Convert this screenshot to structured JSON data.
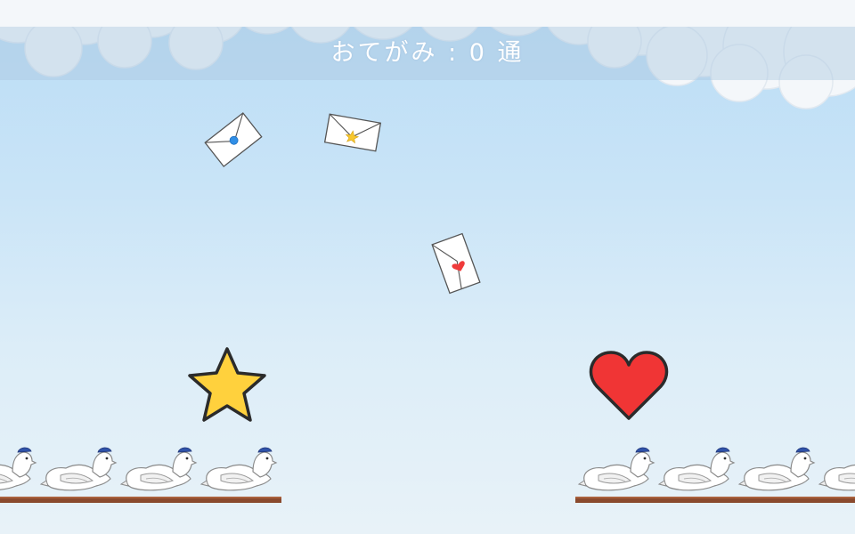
{
  "hud": {
    "score_text": "おてがみ : 0 通"
  },
  "letters": [
    {
      "seal": "blue-dot",
      "seal_color": "#2f8ee6"
    },
    {
      "seal": "star",
      "seal_color": "#f7c72e"
    },
    {
      "seal": "heart",
      "seal_color": "#ef3b3b"
    }
  ],
  "targets": [
    {
      "shape": "star",
      "color": "#ffd13d"
    },
    {
      "shape": "heart",
      "color": "#f03535"
    }
  ],
  "perches": [
    {
      "side": "left",
      "pigeons": 4
    },
    {
      "side": "right",
      "pigeons": 4
    }
  ],
  "colors": {
    "sky_top": "#b9dcf6",
    "sky_bottom": "#e8f2f8",
    "perch": "#8a4a2e",
    "pigeon_cap": "#2f52a8"
  }
}
